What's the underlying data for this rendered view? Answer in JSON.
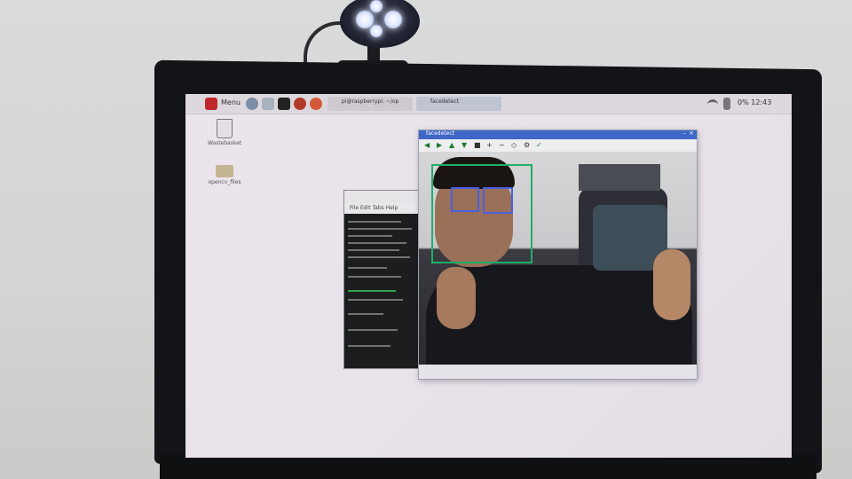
{
  "taskbar": {
    "menu_label": "Menu",
    "window_button_1": "pi@raspberrypi: ~/op",
    "window_button_2": "facedetect",
    "tray_right": "0%  12:43"
  },
  "desktop": {
    "icons": [
      {
        "name": "trash-icon",
        "label": "Wastebasket"
      },
      {
        "name": "folder-icon",
        "label": "opencv_files"
      }
    ]
  },
  "terminal": {
    "menu": "File  Edit  Tabs  Help"
  },
  "video_window": {
    "title": "facedetect",
    "toolbar_icons": [
      "arrow-left-icon",
      "arrow-right-icon",
      "arrow-up-icon",
      "arrow-down-icon",
      "save-icon",
      "zoom-in-icon",
      "zoom-out-icon",
      "zoom-fit-icon",
      "properties-icon",
      "pan-icon"
    ]
  },
  "colors": {
    "face_box": "#1fae6a",
    "eye_box": "#4a5fe0",
    "title_bar": "#3e67c7",
    "cam_led": "#e8efff"
  }
}
